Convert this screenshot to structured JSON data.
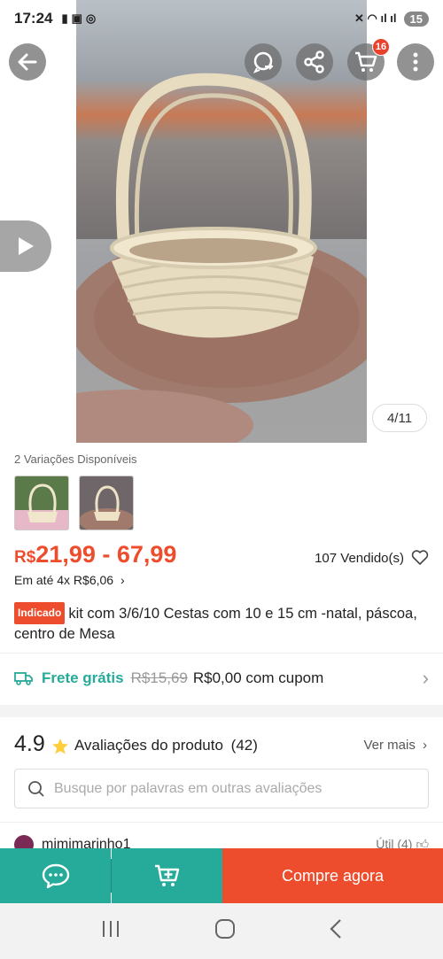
{
  "status_bar": {
    "time": "17:24",
    "battery": "15"
  },
  "header": {
    "cart_badge": "16"
  },
  "image_counter": "4/11",
  "variations": {
    "label": "2 Variações Disponíveis"
  },
  "price": {
    "currency": "R$",
    "range": "21,99 - 67,99"
  },
  "sold": "107 Vendido(s)",
  "installment": "Em até 4x R$6,06",
  "product": {
    "tag": "Indicado",
    "title": "kit com 3/6/10 Cestas com 10 e 15 cm -natal, páscoa, centro de Mesa"
  },
  "shipping": {
    "label": "Frete grátis",
    "old_price": "R$15,69",
    "new_price": "R$0,00 com cupom"
  },
  "reviews": {
    "rating": "4.9",
    "title": "Avaliações do produto",
    "count": "(42)",
    "see_more": "Ver mais",
    "search_placeholder": "Busque por palavras em outras avaliações",
    "first_reviewer": "mimimarinho1",
    "helpful": "Útil (4)"
  },
  "bottom_bar": {
    "buy_label": "Compre agora"
  },
  "colors": {
    "accent": "#ee4d2d",
    "teal": "#26aa99",
    "shipping": "#26aa99"
  }
}
